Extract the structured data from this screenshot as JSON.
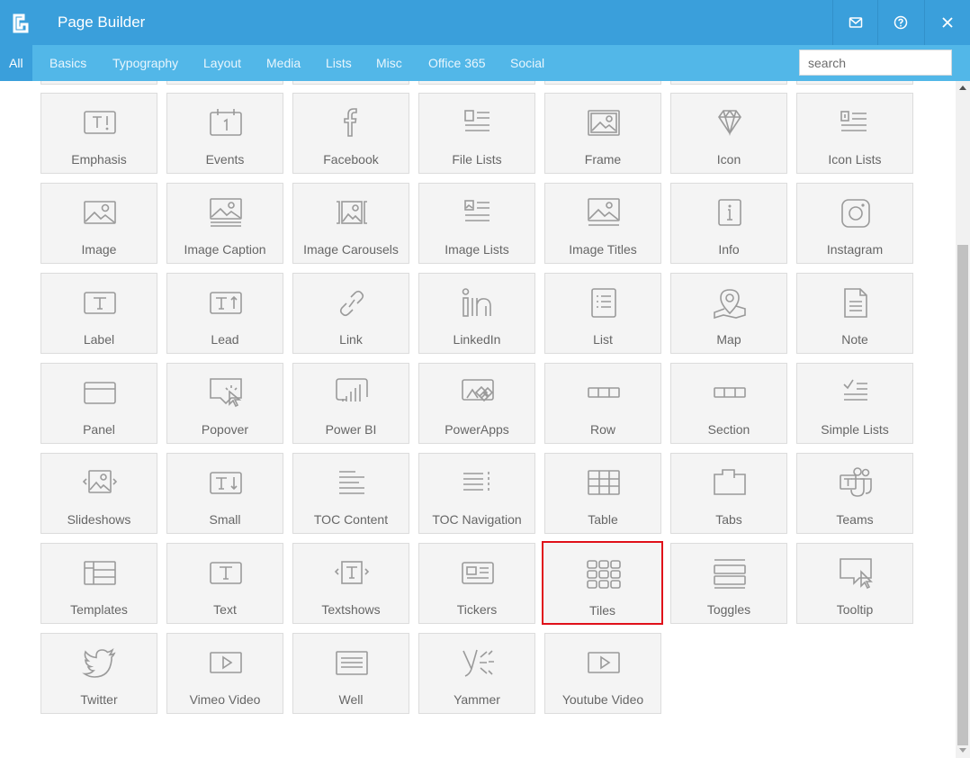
{
  "window": {
    "title": "Page Builder",
    "accent": "#3a9fdb",
    "selected_outline": "#e0101a"
  },
  "toolbar": {
    "mail_icon": "mail-icon",
    "help_icon": "help-icon",
    "close_icon": "close-icon"
  },
  "tabs": [
    "All",
    "Basics",
    "Typography",
    "Layout",
    "Media",
    "Lists",
    "Misc",
    "Office 365",
    "Social"
  ],
  "search": {
    "placeholder": "search",
    "value": ""
  },
  "tiles": [
    {
      "label": "Emphasis",
      "icon": "emphasis-icon"
    },
    {
      "label": "Events",
      "icon": "calendar-icon"
    },
    {
      "label": "Facebook",
      "icon": "facebook-icon"
    },
    {
      "label": "File Lists",
      "icon": "file-list-icon"
    },
    {
      "label": "Frame",
      "icon": "frame-icon"
    },
    {
      "label": "Icon",
      "icon": "diamond-icon"
    },
    {
      "label": "Icon Lists",
      "icon": "icon-list-icon"
    },
    {
      "label": "Image",
      "icon": "image-icon"
    },
    {
      "label": "Image Caption",
      "icon": "image-caption-icon"
    },
    {
      "label": "Image Carousels",
      "icon": "image-carousel-icon"
    },
    {
      "label": "Image Lists",
      "icon": "image-list-icon"
    },
    {
      "label": "Image Titles",
      "icon": "image-title-icon"
    },
    {
      "label": "Info",
      "icon": "info-icon"
    },
    {
      "label": "Instagram",
      "icon": "instagram-icon"
    },
    {
      "label": "Label",
      "icon": "label-icon"
    },
    {
      "label": "Lead",
      "icon": "lead-icon"
    },
    {
      "label": "Link",
      "icon": "link-icon"
    },
    {
      "label": "LinkedIn",
      "icon": "linkedin-icon"
    },
    {
      "label": "List",
      "icon": "list-icon"
    },
    {
      "label": "Map",
      "icon": "map-pin-icon"
    },
    {
      "label": "Note",
      "icon": "note-icon"
    },
    {
      "label": "Panel",
      "icon": "panel-icon"
    },
    {
      "label": "Popover",
      "icon": "popover-icon"
    },
    {
      "label": "Power BI",
      "icon": "power-bi-icon"
    },
    {
      "label": "PowerApps",
      "icon": "powerapps-icon"
    },
    {
      "label": "Row",
      "icon": "row-icon"
    },
    {
      "label": "Section",
      "icon": "section-icon"
    },
    {
      "label": "Simple Lists",
      "icon": "checklist-icon"
    },
    {
      "label": "Slideshows",
      "icon": "slideshow-icon"
    },
    {
      "label": "Small",
      "icon": "small-text-icon"
    },
    {
      "label": "TOC Content",
      "icon": "toc-content-icon"
    },
    {
      "label": "TOC Navigation",
      "icon": "toc-navigation-icon"
    },
    {
      "label": "Table",
      "icon": "table-icon"
    },
    {
      "label": "Tabs",
      "icon": "tabs-icon"
    },
    {
      "label": "Teams",
      "icon": "teams-icon"
    },
    {
      "label": "Templates",
      "icon": "templates-icon"
    },
    {
      "label": "Text",
      "icon": "text-icon"
    },
    {
      "label": "Textshows",
      "icon": "textshow-icon"
    },
    {
      "label": "Tickers",
      "icon": "ticker-icon"
    },
    {
      "label": "Tiles",
      "icon": "tiles-icon",
      "selected": true
    },
    {
      "label": "Toggles",
      "icon": "toggles-icon"
    },
    {
      "label": "Tooltip",
      "icon": "tooltip-icon"
    },
    {
      "label": "Twitter",
      "icon": "twitter-icon"
    },
    {
      "label": "Vimeo Video",
      "icon": "vimeo-video-icon"
    },
    {
      "label": "Well",
      "icon": "well-icon"
    },
    {
      "label": "Yammer",
      "icon": "yammer-icon"
    },
    {
      "label": "Youtube Video",
      "icon": "youtube-video-icon"
    }
  ]
}
